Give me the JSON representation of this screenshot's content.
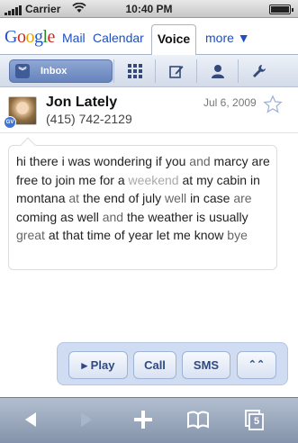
{
  "status_bar": {
    "carrier": "Carrier",
    "time": "10:40 PM"
  },
  "nav": {
    "logo": [
      "G",
      "o",
      "o",
      "g",
      "l",
      "e"
    ],
    "links": [
      "Mail",
      "Calendar",
      "Voice",
      "more ▼"
    ],
    "active": "Voice"
  },
  "toolbar": {
    "inbox_label": "Inbox",
    "icons": [
      "apps-grid-icon",
      "compose-icon",
      "contacts-icon",
      "settings-wrench-icon"
    ]
  },
  "message": {
    "contact_name": "Jon Lately",
    "phone": "(415) 742-2129",
    "date": "Jul 6, 2009",
    "badge": "GV"
  },
  "transcript": {
    "words": [
      {
        "t": "hi",
        "c": "hi"
      },
      {
        "t": "there",
        "c": "hi"
      },
      {
        "t": "i",
        "c": "hi"
      },
      {
        "t": "was",
        "c": "hi"
      },
      {
        "t": "wondering",
        "c": "hi"
      },
      {
        "t": "if",
        "c": "hi"
      },
      {
        "t": "you",
        "c": "hi"
      },
      {
        "t": "and",
        "c": "mid"
      },
      {
        "t": "marcy",
        "c": "hi"
      },
      {
        "t": "are",
        "c": "hi"
      },
      {
        "t": "free",
        "c": "hi"
      },
      {
        "t": "to",
        "c": "hi"
      },
      {
        "t": "join",
        "c": "hi"
      },
      {
        "t": "me",
        "c": "hi"
      },
      {
        "t": "for",
        "c": "hi"
      },
      {
        "t": "a",
        "c": "hi"
      },
      {
        "t": "weekend",
        "c": "low"
      },
      {
        "t": "at",
        "c": "hi"
      },
      {
        "t": "my",
        "c": "hi"
      },
      {
        "t": "cabin",
        "c": "hi"
      },
      {
        "t": "in",
        "c": "hi"
      },
      {
        "t": "montana",
        "c": "hi"
      },
      {
        "t": "at",
        "c": "mid"
      },
      {
        "t": "the",
        "c": "hi"
      },
      {
        "t": "end",
        "c": "hi"
      },
      {
        "t": "of",
        "c": "hi"
      },
      {
        "t": "july",
        "c": "hi"
      },
      {
        "t": "well",
        "c": "mid"
      },
      {
        "t": "in",
        "c": "hi"
      },
      {
        "t": "case",
        "c": "hi"
      },
      {
        "t": "are",
        "c": "mid"
      },
      {
        "t": "coming",
        "c": "hi"
      },
      {
        "t": "as",
        "c": "hi"
      },
      {
        "t": "well",
        "c": "hi"
      },
      {
        "t": "and",
        "c": "mid"
      },
      {
        "t": "the",
        "c": "hi"
      },
      {
        "t": "weather",
        "c": "hi"
      },
      {
        "t": "is",
        "c": "hi"
      },
      {
        "t": "usually",
        "c": "hi"
      },
      {
        "t": "great",
        "c": "mid"
      },
      {
        "t": "at",
        "c": "hi"
      },
      {
        "t": "that",
        "c": "hi"
      },
      {
        "t": "time",
        "c": "hi"
      },
      {
        "t": "of",
        "c": "hi"
      },
      {
        "t": "year",
        "c": "hi"
      },
      {
        "t": "let",
        "c": "hi"
      },
      {
        "t": "me",
        "c": "hi"
      },
      {
        "t": "know",
        "c": "hi"
      },
      {
        "t": "bye",
        "c": "mid"
      }
    ]
  },
  "actions": {
    "play": "▸ Play",
    "call": "Call",
    "sms": "SMS",
    "collapse": "⌃⌃"
  },
  "bottom_bar": {
    "tabs_count": "5"
  },
  "colors": {
    "link_blue": "#1f4fc0",
    "toolbar_blue": "#6683bd",
    "action_text": "#2f4a83"
  }
}
